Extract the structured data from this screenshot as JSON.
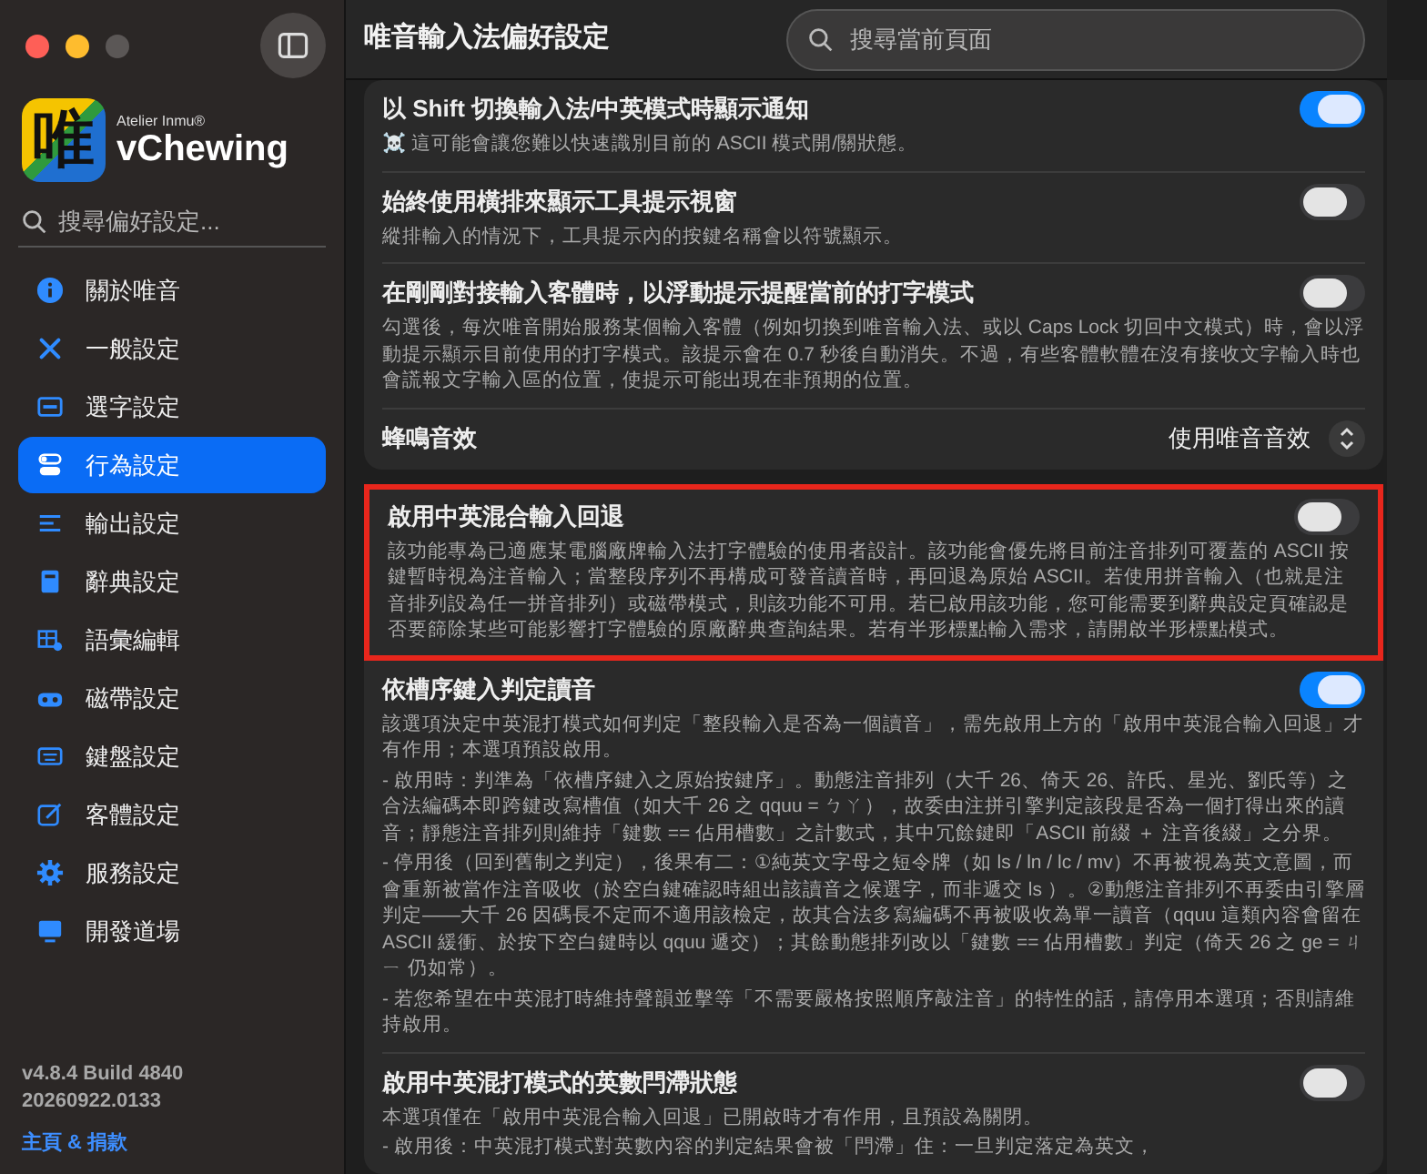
{
  "sidebar": {
    "logo": {
      "glyph": "唯",
      "maker": "Atelier Inmu®",
      "brand": "vChewing"
    },
    "search": {
      "placeholder": "搜尋偏好設定..."
    },
    "items": [
      {
        "label": "關於唯音",
        "selected": false
      },
      {
        "label": "一般設定",
        "selected": false
      },
      {
        "label": "選字設定",
        "selected": false
      },
      {
        "label": "行為設定",
        "selected": true
      },
      {
        "label": "輸出設定",
        "selected": false
      },
      {
        "label": "辭典設定",
        "selected": false
      },
      {
        "label": "語彙編輯",
        "selected": false
      },
      {
        "label": "磁帶設定",
        "selected": false
      },
      {
        "label": "鍵盤設定",
        "selected": false
      },
      {
        "label": "客體設定",
        "selected": false
      },
      {
        "label": "服務設定",
        "selected": false
      },
      {
        "label": "開發道場",
        "selected": false
      }
    ],
    "version": "v4.8.4 Build 4840",
    "build": "20260922.0133",
    "link": "主頁 & 捐款"
  },
  "main": {
    "title": "唯音輸入法偏好設定",
    "search": {
      "placeholder": "搜尋當前頁面"
    },
    "groups": [
      {
        "rows": [
          {
            "kind": "toggle",
            "title": "以 Shift 切換輸入法/中英模式時顯示通知",
            "on": true,
            "highlighted": false,
            "description": [
              "☠️ 這可能會讓您難以快速識別目前的 ASCII 模式開/關狀態。"
            ]
          },
          {
            "kind": "toggle",
            "title": "始終使用橫排來顯示工具提示視窗",
            "on": false,
            "highlighted": false,
            "description": [
              "縱排輸入的情況下，工具提示內的按鍵名稱會以符號顯示。"
            ]
          },
          {
            "kind": "toggle",
            "title": "在剛剛對接輸入客體時，以浮動提示提醒當前的打字模式",
            "on": false,
            "highlighted": false,
            "description": [
              "勾選後，每次唯音開始服務某個輸入客體（例如切換到唯音輸入法、或以 Caps Lock 切回中文模式）時，會以浮動提示顯示目前使用的打字模式。該提示會在 0.7 秒後自動消失。不過，有些客體軟體在沒有接收文字輸入時也會謊報文字輸入區的位置，使提示可能出現在非預期的位置。"
            ]
          },
          {
            "kind": "popup",
            "title": "蜂鳴音效",
            "value": "使用唯音音效",
            "highlighted": false
          }
        ]
      },
      {
        "rows": [
          {
            "kind": "toggle",
            "title": "啟用中英混合輸入回退",
            "on": false,
            "highlighted": true,
            "description": [
              "該功能專為已適應某電腦廠牌輸入法打字體驗的使用者設計。該功能會優先將目前注音排列可覆蓋的 ASCII 按鍵暫時視為注音輸入；當整段序列不再構成可發音讀音時，再回退為原始 ASCII。若使用拼音輸入（也就是注音排列設為任一拼音排列）或磁帶模式，則該功能不可用。若已啟用該功能，您可能需要到辭典設定頁確認是否要篩除某些可能影響打字體驗的原廠辭典查詢結果。若有半形標點輸入需求，請開啟半形標點模式。"
            ]
          },
          {
            "kind": "toggle",
            "title": "依槽序鍵入判定讀音",
            "on": true,
            "highlighted": false,
            "description": [
              "該選項決定中英混打模式如何判定「整段輸入是否為一個讀音」，需先啟用上方的「啟用中英混合輸入回退」才有作用；本選項預設啟用。",
              "- 啟用時：判準為「依槽序鍵入之原始按鍵序」。動態注音排列（大千 26、倚天 26、許氏、星光、劉氏等）之合法編碼本即跨鍵改寫槽值（如大千 26 之 qquu = ㄅㄚ），故委由注拼引擎判定該段是否為一個打得出來的讀音；靜態注音排列則維持「鍵數 == 佔用槽數」之計數式，其中冗餘鍵即「ASCII 前綴 ＋ 注音後綴」之分界。",
              "- 停用後（回到舊制之判定），後果有二：①純英文字母之短令牌（如 ls / ln / lc / mv）不再被視為英文意圖，而會重新被當作注音吸收（於空白鍵確認時組出該讀音之候選字，而非遞交 ls ）。②動態注音排列不再委由引擎層判定——大千 26 因碼長不定而不適用該檢定，故其合法多寫編碼不再被吸收為單一讀音（qquu 這類內容會留在 ASCII 緩衝、於按下空白鍵時以 qquu 遞交）；其餘動態排列改以「鍵數 == 佔用槽數」判定（倚天 26 之 ge = ㄐㄧ 仍如常）。",
              "- 若您希望在中英混打時維持聲韻並擊等「不需要嚴格按照順序敲注音」的特性的話，請停用本選項；否則請維持啟用。"
            ]
          },
          {
            "kind": "toggle",
            "title": "啟用中英混打模式的英數閂滯狀態",
            "on": false,
            "highlighted": false,
            "description": [
              "本選項僅在「啟用中英混合輸入回退」已開啟時才有作用，且預設為關閉。",
              "- 啟用後：中英混打模式對英數內容的判定結果會被「閂滯」住：一旦判定落定為英文，"
            ]
          }
        ]
      }
    ]
  }
}
